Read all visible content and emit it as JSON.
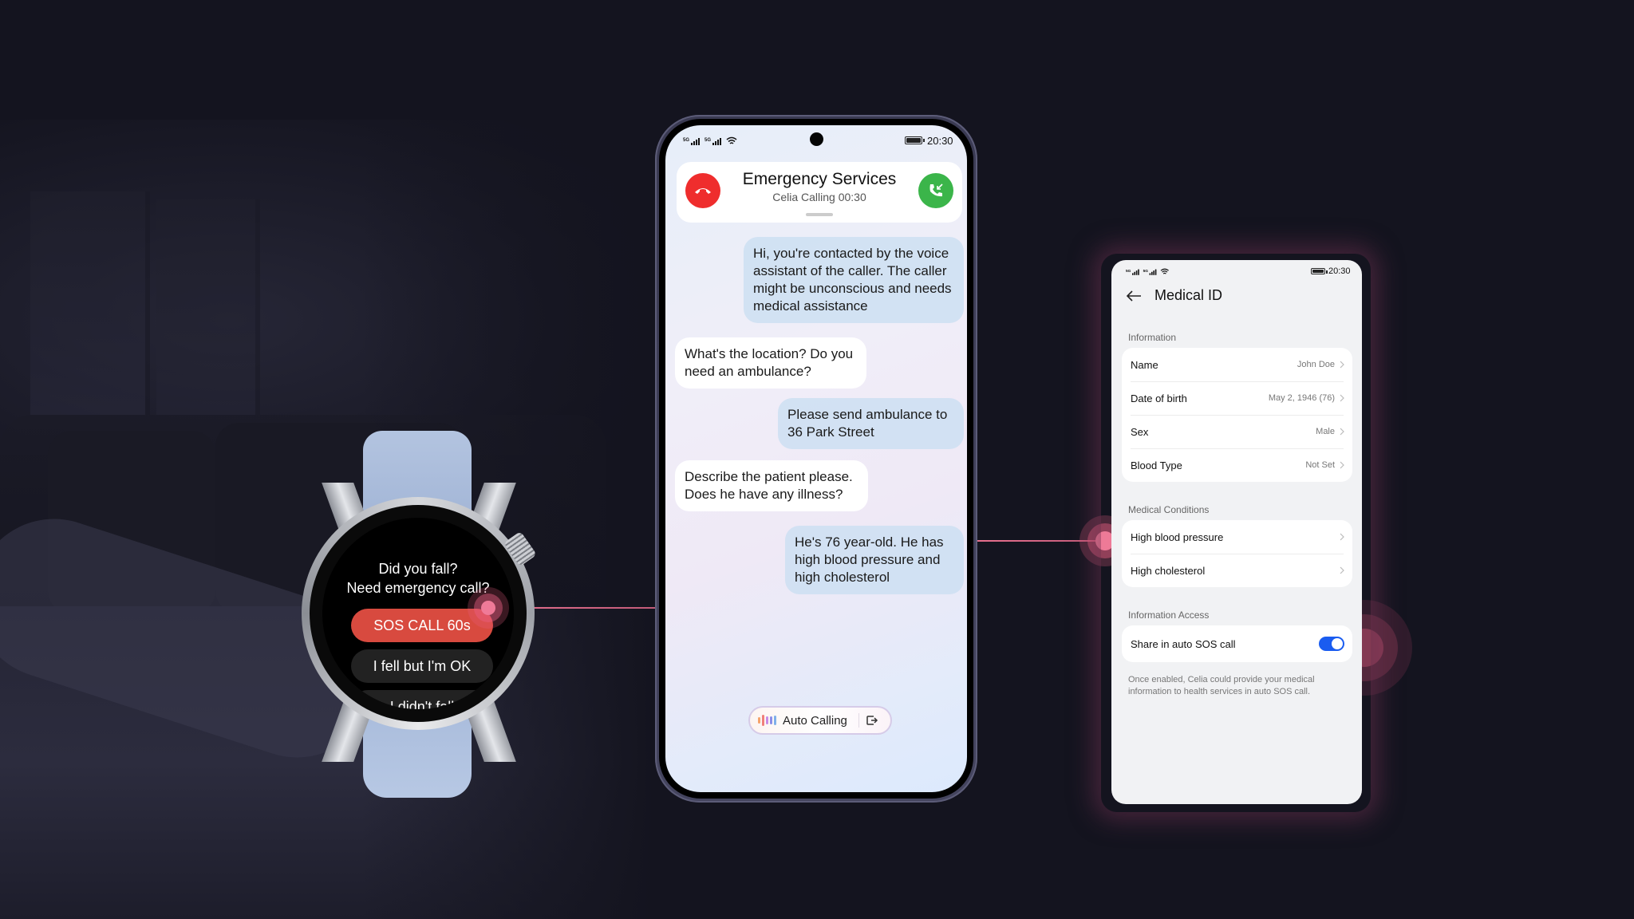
{
  "watch": {
    "prompt_line1": "Did you fall?",
    "prompt_line2": "Need emergency call?",
    "buttons": [
      {
        "label": "SOS CALL 60s",
        "color": "#d84a3f"
      },
      {
        "label": "I fell but I'm OK"
      },
      {
        "label": "I didn't fall"
      }
    ]
  },
  "phone": {
    "status": {
      "time": "20:30",
      "network1": "5G",
      "network2": "5G",
      "wifi_icon": "wifi-icon",
      "battery_icon": "battery-icon"
    },
    "call": {
      "title": "Emergency Services",
      "subtitle": "Celia Calling 00:30",
      "hangup_icon": "phone-hangup-icon",
      "answer_icon": "phone-incoming-icon",
      "hangup_color": "#ef2d2d",
      "answer_color": "#3bb54a"
    },
    "messages": [
      {
        "side": "out",
        "text": "Hi, you're contacted by the voice assistant of the caller. The caller might be unconscious and needs medical assistance"
      },
      {
        "side": "in",
        "text": "What's the location? Do you need an ambulance?"
      },
      {
        "side": "out",
        "text": "Please send ambulance to 36 Park Street"
      },
      {
        "side": "in",
        "text": "Describe the patient please. Does he have any illness?"
      },
      {
        "side": "out",
        "text": "He's 76 year-old. He has high blood pressure and high cholesterol"
      }
    ],
    "auto_calling": {
      "label": "Auto Calling",
      "voice_icon": "voice-wave-icon",
      "exit_icon": "exit-icon"
    }
  },
  "medical_id": {
    "status": {
      "time": "20:30",
      "network1": "5G",
      "network2": "5G"
    },
    "title": "Medical ID",
    "back_icon": "back-arrow-icon",
    "sections": {
      "information": {
        "label": "Information",
        "rows": [
          {
            "label": "Name",
            "value": "John Doe"
          },
          {
            "label": "Date of birth",
            "value": "May 2, 1946 (76)"
          },
          {
            "label": "Sex",
            "value": "Male"
          },
          {
            "label": "Blood Type",
            "value": "Not Set"
          }
        ]
      },
      "conditions": {
        "label": "Medical Conditions",
        "rows": [
          {
            "label": "High blood pressure"
          },
          {
            "label": "High cholesterol"
          }
        ]
      },
      "access": {
        "label": "Information Access",
        "toggle_label": "Share in auto SOS call",
        "toggle_on": true,
        "toggle_color": "#1a5cf0",
        "footnote": "Once enabled, Celia could provide your medical information to health services in auto SOS call."
      }
    }
  },
  "accent": {
    "connector": "#e8708e",
    "background": "#14141f"
  }
}
